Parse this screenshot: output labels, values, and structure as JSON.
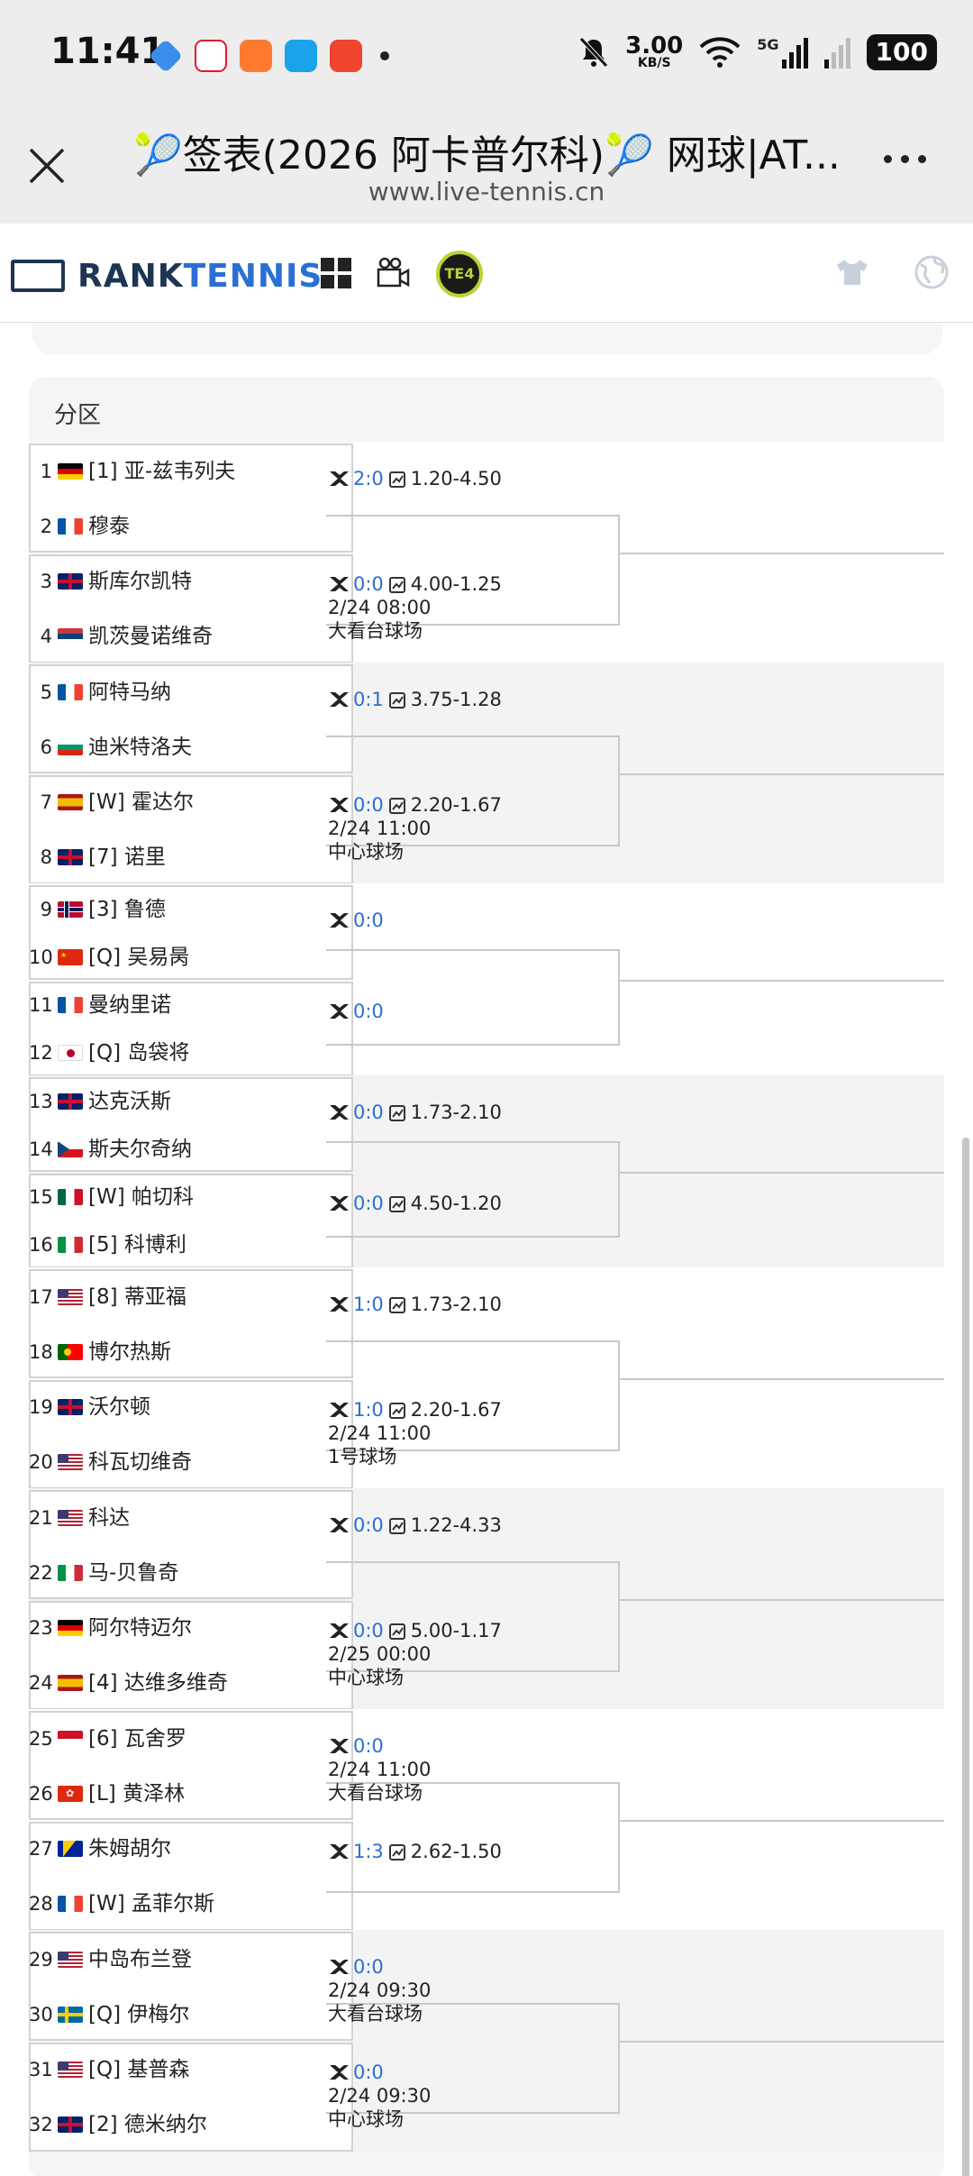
{
  "status": {
    "time": "11:41",
    "speed": "3.00",
    "speed_unit": "KB/S",
    "network": "5G",
    "battery": "100"
  },
  "browser": {
    "title": "🎾签表(2026 阿卡普尔科)🎾 网球|AT...",
    "url": "www.live-tennis.cn"
  },
  "site": {
    "logo_a": "RANK",
    "logo_b": "TENNIS",
    "te4": "TE4"
  },
  "section_title": "分区",
  "quarters": [
    {
      "players": [
        {
          "num": "1",
          "flag": "de",
          "name": "[1] 亚-兹韦列夫"
        },
        {
          "num": "2",
          "flag": "fr",
          "name": "穆泰"
        },
        {
          "num": "3",
          "flag": "au",
          "name": "斯库尔凯特"
        },
        {
          "num": "4",
          "flag": "rs",
          "name": "凯茨曼诺维奇"
        }
      ],
      "m1": {
        "score": "2:0",
        "odds": "1.20-4.50"
      },
      "m2": {
        "score": "0:0",
        "odds": "4.00-1.25",
        "time": "2/24 08:00",
        "court": "大看台球场"
      }
    },
    {
      "players": [
        {
          "num": "5",
          "flag": "fr",
          "name": "阿特马纳"
        },
        {
          "num": "6",
          "flag": "bg",
          "name": "迪米特洛夫"
        },
        {
          "num": "7",
          "flag": "es",
          "name": "[W] 霍达尔"
        },
        {
          "num": "8",
          "flag": "gb",
          "name": "[7] 诺里"
        }
      ],
      "m1": {
        "score": "0:1",
        "odds": "3.75-1.28"
      },
      "m2": {
        "score": "0:0",
        "odds": "2.20-1.67",
        "time": "2/24 11:00",
        "court": "中心球场"
      }
    },
    {
      "players": [
        {
          "num": "9",
          "flag": "no",
          "name": "[3] 鲁德"
        },
        {
          "num": "10",
          "flag": "cn",
          "name": "[Q] 吴易昺"
        },
        {
          "num": "11",
          "flag": "fr",
          "name": "曼纳里诺"
        },
        {
          "num": "12",
          "flag": "jp",
          "name": "[Q] 岛袋将"
        }
      ],
      "m1": {
        "score": "0:0",
        "odds": ""
      },
      "m2": {
        "score": "0:0",
        "odds": "",
        "time": "",
        "court": ""
      }
    },
    {
      "players": [
        {
          "num": "13",
          "flag": "au",
          "name": "达克沃斯"
        },
        {
          "num": "14",
          "flag": "cz",
          "name": "斯夫尔奇纳"
        },
        {
          "num": "15",
          "flag": "mx",
          "name": "[W] 帕切科"
        },
        {
          "num": "16",
          "flag": "it",
          "name": "[5] 科博利"
        }
      ],
      "m1": {
        "score": "0:0",
        "odds": "1.73-2.10"
      },
      "m2": {
        "score": "0:0",
        "odds": "4.50-1.20",
        "time": "",
        "court": ""
      }
    },
    {
      "players": [
        {
          "num": "17",
          "flag": "us",
          "name": "[8] 蒂亚福"
        },
        {
          "num": "18",
          "flag": "pt",
          "name": "博尔热斯"
        },
        {
          "num": "19",
          "flag": "au",
          "name": "沃尔顿"
        },
        {
          "num": "20",
          "flag": "us",
          "name": "科瓦切维奇"
        }
      ],
      "m1": {
        "score": "1:0",
        "odds": "1.73-2.10"
      },
      "m2": {
        "score": "1:0",
        "odds": "2.20-1.67",
        "time": "2/24 11:00",
        "court": "1号球场"
      }
    },
    {
      "players": [
        {
          "num": "21",
          "flag": "us",
          "name": "科达"
        },
        {
          "num": "22",
          "flag": "it",
          "name": "马-贝鲁奇"
        },
        {
          "num": "23",
          "flag": "de",
          "name": "阿尔特迈尔"
        },
        {
          "num": "24",
          "flag": "es",
          "name": "[4] 达维多维奇"
        }
      ],
      "m1": {
        "score": "0:0",
        "odds": "1.22-4.33"
      },
      "m2": {
        "score": "0:0",
        "odds": "5.00-1.17",
        "time": "2/25 00:00",
        "court": "中心球场"
      }
    },
    {
      "players": [
        {
          "num": "25",
          "flag": "id",
          "name": "[6] 瓦舍罗"
        },
        {
          "num": "26",
          "flag": "hk",
          "name": "[L] 黄泽林"
        },
        {
          "num": "27",
          "flag": "ba",
          "name": "朱姆胡尔"
        },
        {
          "num": "28",
          "flag": "fr",
          "name": "[W] 孟菲尔斯"
        }
      ],
      "m1": {
        "score": "0:0",
        "odds": "",
        "time": "2/24 11:00",
        "court": "大看台球场"
      },
      "m2": {
        "score": "1:3",
        "odds": "2.62-1.50",
        "time": "",
        "court": ""
      }
    },
    {
      "players": [
        {
          "num": "29",
          "flag": "us",
          "name": "中岛布兰登"
        },
        {
          "num": "30",
          "flag": "se",
          "name": "[Q] 伊梅尔"
        },
        {
          "num": "31",
          "flag": "us",
          "name": "[Q] 基普森"
        },
        {
          "num": "32",
          "flag": "au",
          "name": "[2] 德米纳尔"
        }
      ],
      "m1": {
        "score": "0:0",
        "odds": "",
        "time": "2/24 09:30",
        "court": "大看台球场"
      },
      "m2": {
        "score": "0:0",
        "odds": "",
        "time": "2/24 09:30",
        "court": "中心球场"
      }
    }
  ]
}
